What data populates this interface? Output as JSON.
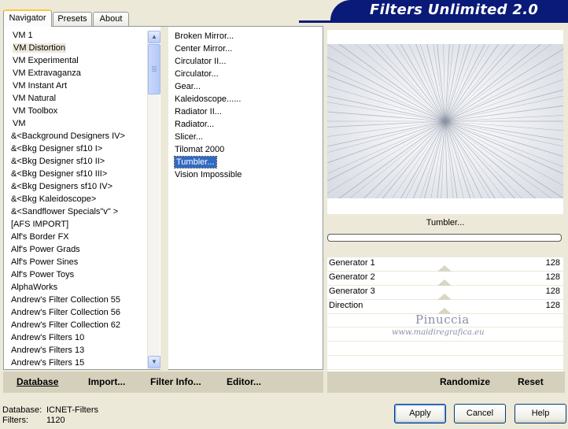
{
  "tabs": [
    {
      "label": "Navigator",
      "active": true
    },
    {
      "label": "Presets",
      "active": false
    },
    {
      "label": "About",
      "active": false
    }
  ],
  "header": {
    "title": "Filters Unlimited 2.0"
  },
  "categories": [
    {
      "label": "VM 1"
    },
    {
      "label": "VM Distortion",
      "selected": true
    },
    {
      "label": "VM Experimental"
    },
    {
      "label": "VM Extravaganza"
    },
    {
      "label": "VM Instant Art"
    },
    {
      "label": "VM Natural"
    },
    {
      "label": "VM Toolbox"
    },
    {
      "label": "VM"
    },
    {
      "label": "&<Background Designers IV>"
    },
    {
      "label": "&<Bkg Designer sf10 I>"
    },
    {
      "label": "&<Bkg Designer sf10 II>"
    },
    {
      "label": "&<Bkg Designer sf10 III>"
    },
    {
      "label": "&<Bkg Designers sf10 IV>"
    },
    {
      "label": "&<Bkg Kaleidoscope>"
    },
    {
      "label": "&<Sandflower Specials\"v\" >"
    },
    {
      "label": "[AFS IMPORT]"
    },
    {
      "label": "Alf's Border FX"
    },
    {
      "label": "Alf's Power Grads"
    },
    {
      "label": "Alf's Power Sines"
    },
    {
      "label": "Alf's Power Toys"
    },
    {
      "label": "AlphaWorks"
    },
    {
      "label": "Andrew's Filter Collection 55"
    },
    {
      "label": "Andrew's Filter Collection 56"
    },
    {
      "label": "Andrew's Filter Collection 62"
    },
    {
      "label": "Andrew's Filters 10"
    },
    {
      "label": "Andrew's Filters 13"
    },
    {
      "label": "Andrew's Filters 15"
    }
  ],
  "filters": [
    {
      "label": "Broken Mirror..."
    },
    {
      "label": "Center Mirror..."
    },
    {
      "label": "Circulator II..."
    },
    {
      "label": "Circulator..."
    },
    {
      "label": "Gear..."
    },
    {
      "label": "Kaleidoscope......"
    },
    {
      "label": "Radiator II..."
    },
    {
      "label": "Radiator..."
    },
    {
      "label": "Slicer..."
    },
    {
      "label": "Tilomat 2000"
    },
    {
      "label": "Tumbler...",
      "selected": true
    },
    {
      "label": "Vision Impossible"
    }
  ],
  "toolbar": {
    "database": "Database",
    "import": "Import...",
    "filter_info": "Filter Info...",
    "editor": "Editor...",
    "randomize": "Randomize",
    "reset": "Reset"
  },
  "preview": {
    "filter_name": "Tumbler..."
  },
  "params": [
    {
      "label": "Generator 1",
      "value": "128"
    },
    {
      "label": "Generator 2",
      "value": "128"
    },
    {
      "label": "Generator 3",
      "value": "128"
    },
    {
      "label": "Direction",
      "value": "128"
    }
  ],
  "watermark": {
    "name": "Pinuccia",
    "url": "www.maidiregrafica.eu"
  },
  "status": {
    "database_label": "Database:",
    "database_value": "ICNET-Filters",
    "filters_label": "Filters:",
    "filters_value": "1120"
  },
  "buttons": {
    "apply": "Apply",
    "cancel": "Cancel",
    "help": "Help"
  },
  "colors": {
    "banner": "#0A1A78",
    "selection": "#316AC5",
    "face": "#ECE9D8"
  }
}
